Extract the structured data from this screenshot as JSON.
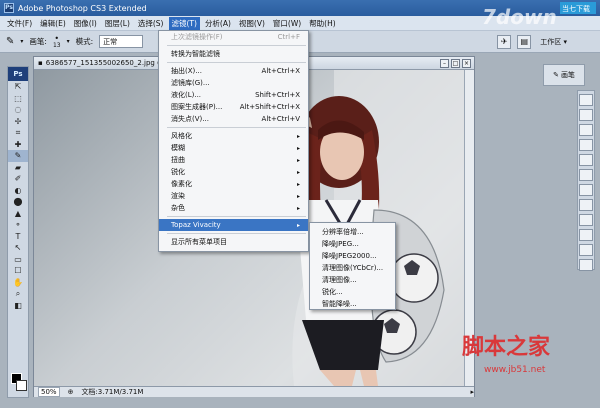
{
  "app": {
    "title": "Adobe Photoshop CS3 Extended",
    "ps_badge": "Ps",
    "ps_mini_badge": "Ps"
  },
  "menubar": {
    "items": [
      "文件(F)",
      "编辑(E)",
      "图像(I)",
      "图层(L)",
      "选择(S)",
      "滤镜(T)",
      "分析(A)",
      "视图(V)",
      "窗口(W)",
      "帮助(H)"
    ],
    "active_index": 5
  },
  "options": {
    "brush_label": "画笔:",
    "brush_size": "13",
    "mode_label": "模式:",
    "mode_value": "正常",
    "workspace_label": "工作区 ▾"
  },
  "document": {
    "title": "6386577_151355002650_2.jpg @ 50% (RGB/8)",
    "zoom": "50%",
    "doc_size": "文档:3.71M/3.71M"
  },
  "right_panel": {
    "label": "画笔"
  },
  "filter_menu": {
    "items": [
      {
        "label": "上次滤镜操作(F)",
        "shortcut": "Ctrl+F",
        "disabled": true
      },
      {
        "sep": true
      },
      {
        "label": "转换为智能滤镜",
        "shortcut": ""
      },
      {
        "sep": true
      },
      {
        "label": "抽出(X)...",
        "shortcut": "Alt+Ctrl+X"
      },
      {
        "label": "滤镜库(G)...",
        "shortcut": ""
      },
      {
        "label": "液化(L)...",
        "shortcut": "Shift+Ctrl+X"
      },
      {
        "label": "图案生成器(P)...",
        "shortcut": "Alt+Shift+Ctrl+X"
      },
      {
        "label": "消失点(V)...",
        "shortcut": "Alt+Ctrl+V"
      },
      {
        "sep": true
      },
      {
        "label": "风格化",
        "shortcut": "",
        "submenu": true
      },
      {
        "label": "模糊",
        "shortcut": "",
        "submenu": true
      },
      {
        "label": "扭曲",
        "shortcut": "",
        "submenu": true
      },
      {
        "label": "锐化",
        "shortcut": "",
        "submenu": true
      },
      {
        "label": "像素化",
        "shortcut": "",
        "submenu": true
      },
      {
        "label": "渲染",
        "shortcut": "",
        "submenu": true
      },
      {
        "label": "杂色",
        "shortcut": "",
        "submenu": true
      },
      {
        "sep": true
      },
      {
        "label": "Topaz Vivacity",
        "shortcut": "",
        "submenu": true,
        "highlighted": true
      },
      {
        "sep": true
      },
      {
        "label": "显示所有菜单项目",
        "shortcut": ""
      }
    ]
  },
  "topaz_submenu": {
    "items": [
      "分辨率倍增...",
      "降噪JPEG...",
      "降噪JPEG2000...",
      "清理图像(YCbCr)...",
      "清理图像...",
      "锐化...",
      "智能降噪..."
    ]
  },
  "watermarks": {
    "top_logo": "7down",
    "top_cn": "当七下载",
    "bottom_cn": "脚本之家",
    "bottom_url": "www.jb51.net"
  },
  "colors": {
    "menu_highlight": "#3a75c4",
    "titlebar": "#2a5c9e",
    "watermark_red": "#d9383a"
  }
}
